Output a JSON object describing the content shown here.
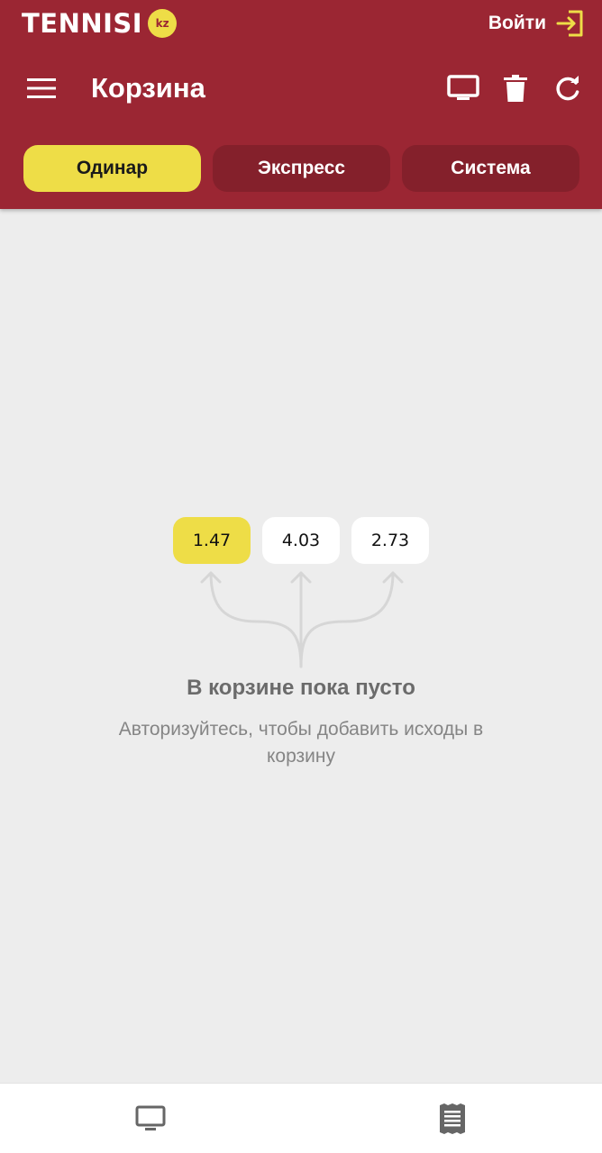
{
  "brand": {
    "name": "TENNISI",
    "badge": "kz"
  },
  "header": {
    "login_label": "Войти",
    "title": "Корзина",
    "icons": {
      "menu": "hamburger-menu-icon",
      "login": "login-arrow-icon",
      "tv": "tv-icon",
      "trash": "trash-icon",
      "refresh": "refresh-icon"
    }
  },
  "tabs": [
    {
      "label": "Одинар",
      "active": true
    },
    {
      "label": "Экспресс",
      "active": false
    },
    {
      "label": "Система",
      "active": false
    }
  ],
  "empty_state": {
    "odds": [
      "1.47",
      "4.03",
      "2.73"
    ],
    "title": "В корзине пока пусто",
    "subtitle": "Авторизуйтесь, чтобы добавить исходы в корзину"
  },
  "bottom_nav": {
    "icons": {
      "left": "tv-icon",
      "right": "bet-slip-icon"
    }
  },
  "colors": {
    "brand_red": "#9b2633",
    "tab_inactive": "#84202b",
    "accent_yellow": "#eedd47",
    "background": "#ededed"
  }
}
